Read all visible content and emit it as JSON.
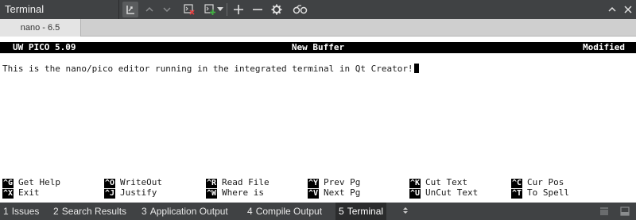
{
  "window": {
    "title": "Terminal"
  },
  "toolbar": {
    "icons": [
      "terminal-focus-icon",
      "prev-arrow-icon",
      "next-arrow-icon",
      "close-terminal-icon",
      "new-terminal-icon",
      "dropdown-arrow-icon",
      "plus-icon",
      "minus-icon",
      "gear-icon",
      "lock-key-icon",
      "collapse-up-icon",
      "close-icon"
    ]
  },
  "tabs": [
    {
      "label": "nano - 6.5"
    }
  ],
  "nano": {
    "status_left": "UW PICO 5.09",
    "status_center": "New Buffer",
    "status_right": "Modified",
    "buffer_text": "This is the nano/pico editor running in the integrated terminal in Qt Creator!",
    "shortcuts": [
      {
        "key": "^G",
        "label": "Get Help"
      },
      {
        "key": "^X",
        "label": "Exit"
      },
      {
        "key": "^O",
        "label": "WriteOut"
      },
      {
        "key": "^J",
        "label": "Justify"
      },
      {
        "key": "^R",
        "label": "Read File"
      },
      {
        "key": "^W",
        "label": "Where is"
      },
      {
        "key": "^Y",
        "label": "Prev Pg"
      },
      {
        "key": "^V",
        "label": "Next Pg"
      },
      {
        "key": "^K",
        "label": "Cut Text"
      },
      {
        "key": "^U",
        "label": "UnCut Text"
      },
      {
        "key": "^C",
        "label": "Cur Pos"
      },
      {
        "key": "^T",
        "label": "To Spell"
      }
    ]
  },
  "output_panes": [
    {
      "num": "1",
      "label": "Issues"
    },
    {
      "num": "2",
      "label": "Search Results"
    },
    {
      "num": "3",
      "label": "Application Output"
    },
    {
      "num": "4",
      "label": "Compile Output"
    },
    {
      "num": "5",
      "label": "Terminal",
      "active": true
    }
  ],
  "colors": {
    "toolbar_bg": "#404244",
    "tabbar_bg": "#cfcfcf",
    "terminal_bg": "#ffffff",
    "status_bg": "#000000",
    "delete_red": "#e04040",
    "add_green": "#40b040"
  }
}
